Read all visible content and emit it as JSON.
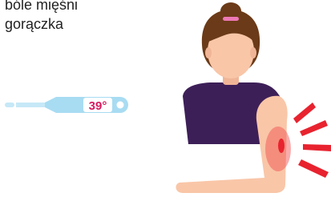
{
  "symptoms": [
    "bóle mięśni",
    "gorączka"
  ],
  "thermometer": {
    "reading": "39°",
    "icon": "thermometer-icon"
  },
  "figure": {
    "icon": "person-arm-pain-icon"
  },
  "colors": {
    "thermometer_body": "#a8dcf2",
    "thermometer_text": "#d81b60",
    "shirt": "#3d1f58",
    "hair": "#6b3a18",
    "skin": "#f9c6a8",
    "pain": "#e8232f"
  }
}
